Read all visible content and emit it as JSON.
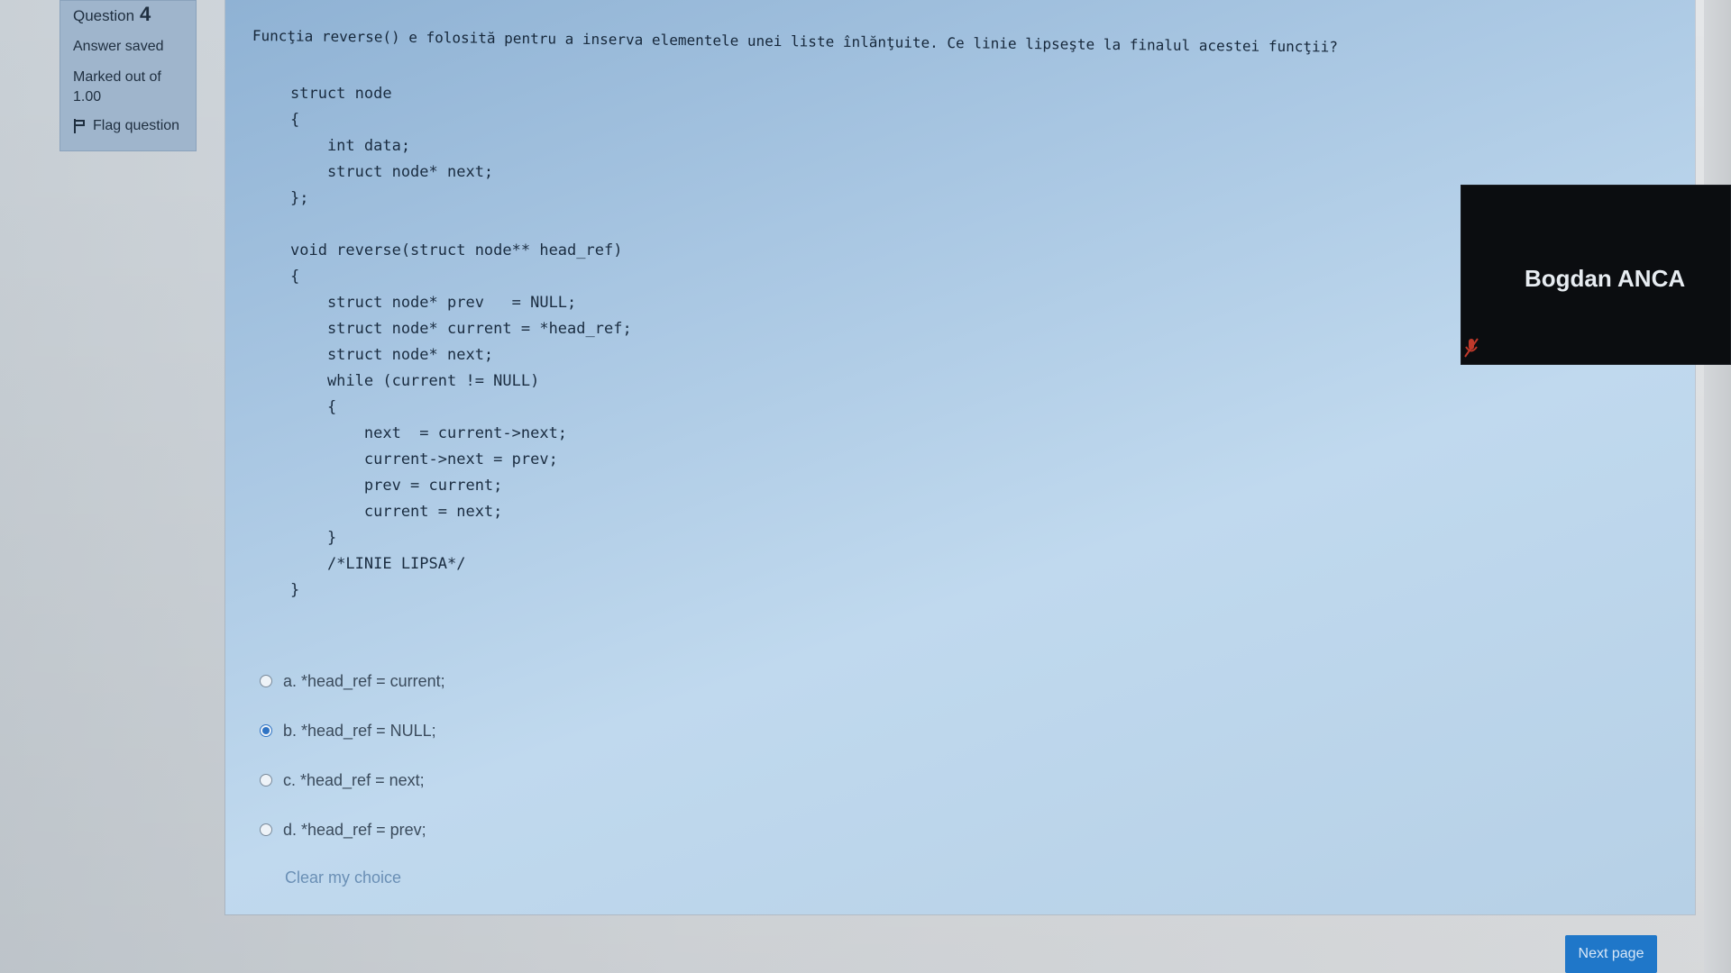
{
  "info": {
    "question_label": "Question",
    "question_number": "4",
    "status": "Answer saved",
    "marked_line1": "Marked out of",
    "marked_line2": "1.00",
    "flag_label": "Flag question"
  },
  "question": {
    "text": "Funcţia reverse() e folosită pentru a inserva elementele unei liste înlănţuite. Ce linie lipseşte la finalul acestei funcţii?",
    "code": [
      "struct node",
      "{",
      "    int data;",
      "    struct node* next;",
      "};",
      "",
      "void reverse(struct node** head_ref)",
      "{",
      "    struct node* prev   = NULL;",
      "    struct node* current = *head_ref;",
      "    struct node* next;",
      "    while (current != NULL)",
      "    {",
      "        next  = current->next;",
      "        current->next = prev;",
      "        prev = current;",
      "        current = next;",
      "    }",
      "    /*LINIE LIPSA*/",
      "}"
    ]
  },
  "answers": [
    {
      "label": "a. *head_ref = current;",
      "selected": false
    },
    {
      "label": "b. *head_ref = NULL;",
      "selected": true
    },
    {
      "label": "c. *head_ref = next;",
      "selected": false
    },
    {
      "label": "d. *head_ref = prev;",
      "selected": false
    }
  ],
  "clear_label": "Clear my choice",
  "video": {
    "participant_name": "Bogdan ANCA",
    "mic_icon": "mic-off-icon"
  },
  "next_button_label": "Next page",
  "colors": {
    "accent": "#1f77c9",
    "panel": "#a8c6e2",
    "info_block": "#9fb5cc"
  }
}
